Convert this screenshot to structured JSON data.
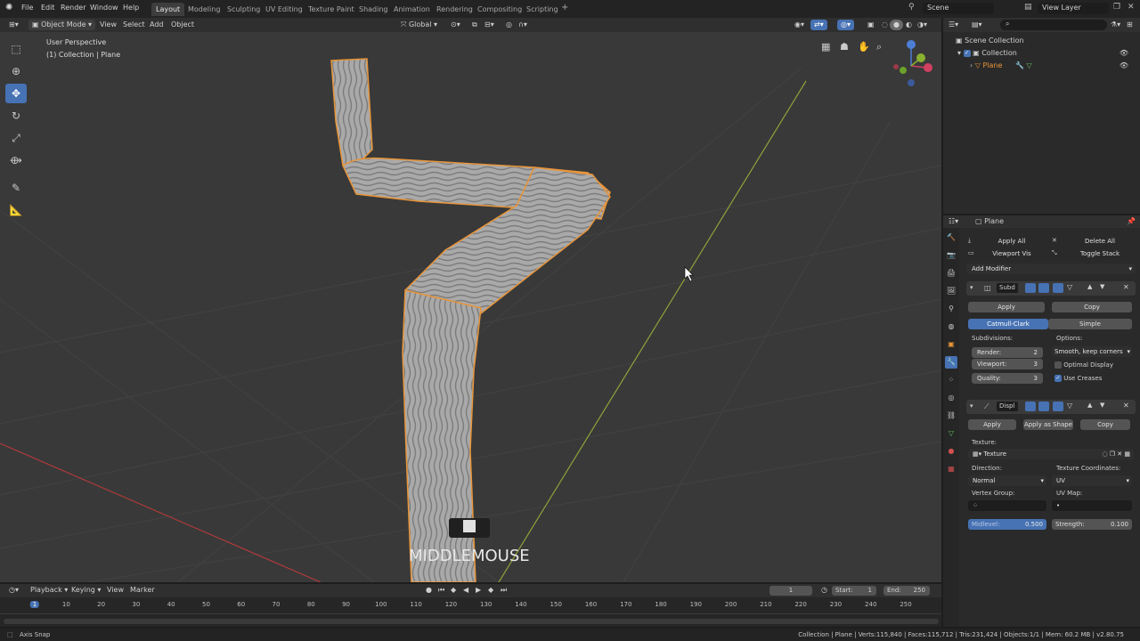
{
  "topbar": {
    "menus": [
      "File",
      "Edit",
      "Render",
      "Window",
      "Help"
    ],
    "workspaces": [
      "Layout",
      "Modeling",
      "Sculpting",
      "UV Editing",
      "Texture Paint",
      "Shading",
      "Animation",
      "Rendering",
      "Compositing",
      "Scripting"
    ],
    "active_workspace": "Layout",
    "scene": "Scene",
    "view_layer": "View Layer"
  },
  "viewport_header": {
    "mode": "Object Mode",
    "menus": [
      "View",
      "Select",
      "Add",
      "Object"
    ],
    "transform_orientation": "Global"
  },
  "viewport": {
    "perspective": "User Perspective",
    "collection_info": "(1) Collection | Plane",
    "key_overlay": "MIDDLEMOUSE"
  },
  "outliner": {
    "root": "Scene Collection",
    "collection": "Collection",
    "object": "Plane"
  },
  "properties": {
    "object_name": "Plane",
    "apply_all": "Apply All",
    "delete_all": "Delete All",
    "viewport_vis": "Viewport Vis",
    "toggle_stack": "Toggle Stack",
    "add_modifier": "Add Modifier",
    "subsurf": {
      "name": "Subd",
      "apply": "Apply",
      "copy": "Copy",
      "catmull": "Catmull-Clark",
      "simple": "Simple",
      "subdivisions_label": "Subdivisions:",
      "options_label": "Options:",
      "render_label": "Render:",
      "render_value": "2",
      "viewport_label": "Viewport:",
      "viewport_value": "3",
      "quality_label": "Quality:",
      "quality_value": "3",
      "uv_smooth": "Smooth, keep corners",
      "optimal_display": "Optimal Display",
      "use_creases": "Use Creases"
    },
    "displace": {
      "name": "Displ",
      "apply": "Apply",
      "apply_shape": "Apply as Shape",
      "copy": "Copy",
      "texture_label": "Texture:",
      "texture_name": "Texture",
      "direction_label": "Direction:",
      "direction_value": "Normal",
      "tex_coords_label": "Texture Coordinates:",
      "tex_coords_value": "UV",
      "vertex_group_label": "Vertex Group:",
      "uv_map_label": "UV Map:",
      "midlevel_label": "Midlevel:",
      "midlevel_value": "0.500",
      "strength_label": "Strength:",
      "strength_value": "0.100"
    }
  },
  "timeline": {
    "menus": [
      "Playback",
      "Keying",
      "View",
      "Marker"
    ],
    "current_frame": "1",
    "start_label": "Start:",
    "start_value": "1",
    "end_label": "End:",
    "end_value": "250",
    "ticks": [
      "1",
      "10",
      "20",
      "30",
      "40",
      "50",
      "60",
      "70",
      "80",
      "90",
      "100",
      "110",
      "120",
      "130",
      "140",
      "150",
      "160",
      "170",
      "180",
      "190",
      "200",
      "210",
      "220",
      "230",
      "240",
      "250"
    ]
  },
  "statusbar": {
    "left": "Axis Snap",
    "right": "Collection | Plane | Verts:115,840 | Faces:115,712 | Tris:231,424 | Objects:1/1 | Mem: 60.2 MB | v2.80.75"
  },
  "colors": {
    "accent": "#4772b3",
    "selection_outline": "#e8953a",
    "x_axis": "#b03a3a",
    "y_axis": "#8da33a"
  }
}
